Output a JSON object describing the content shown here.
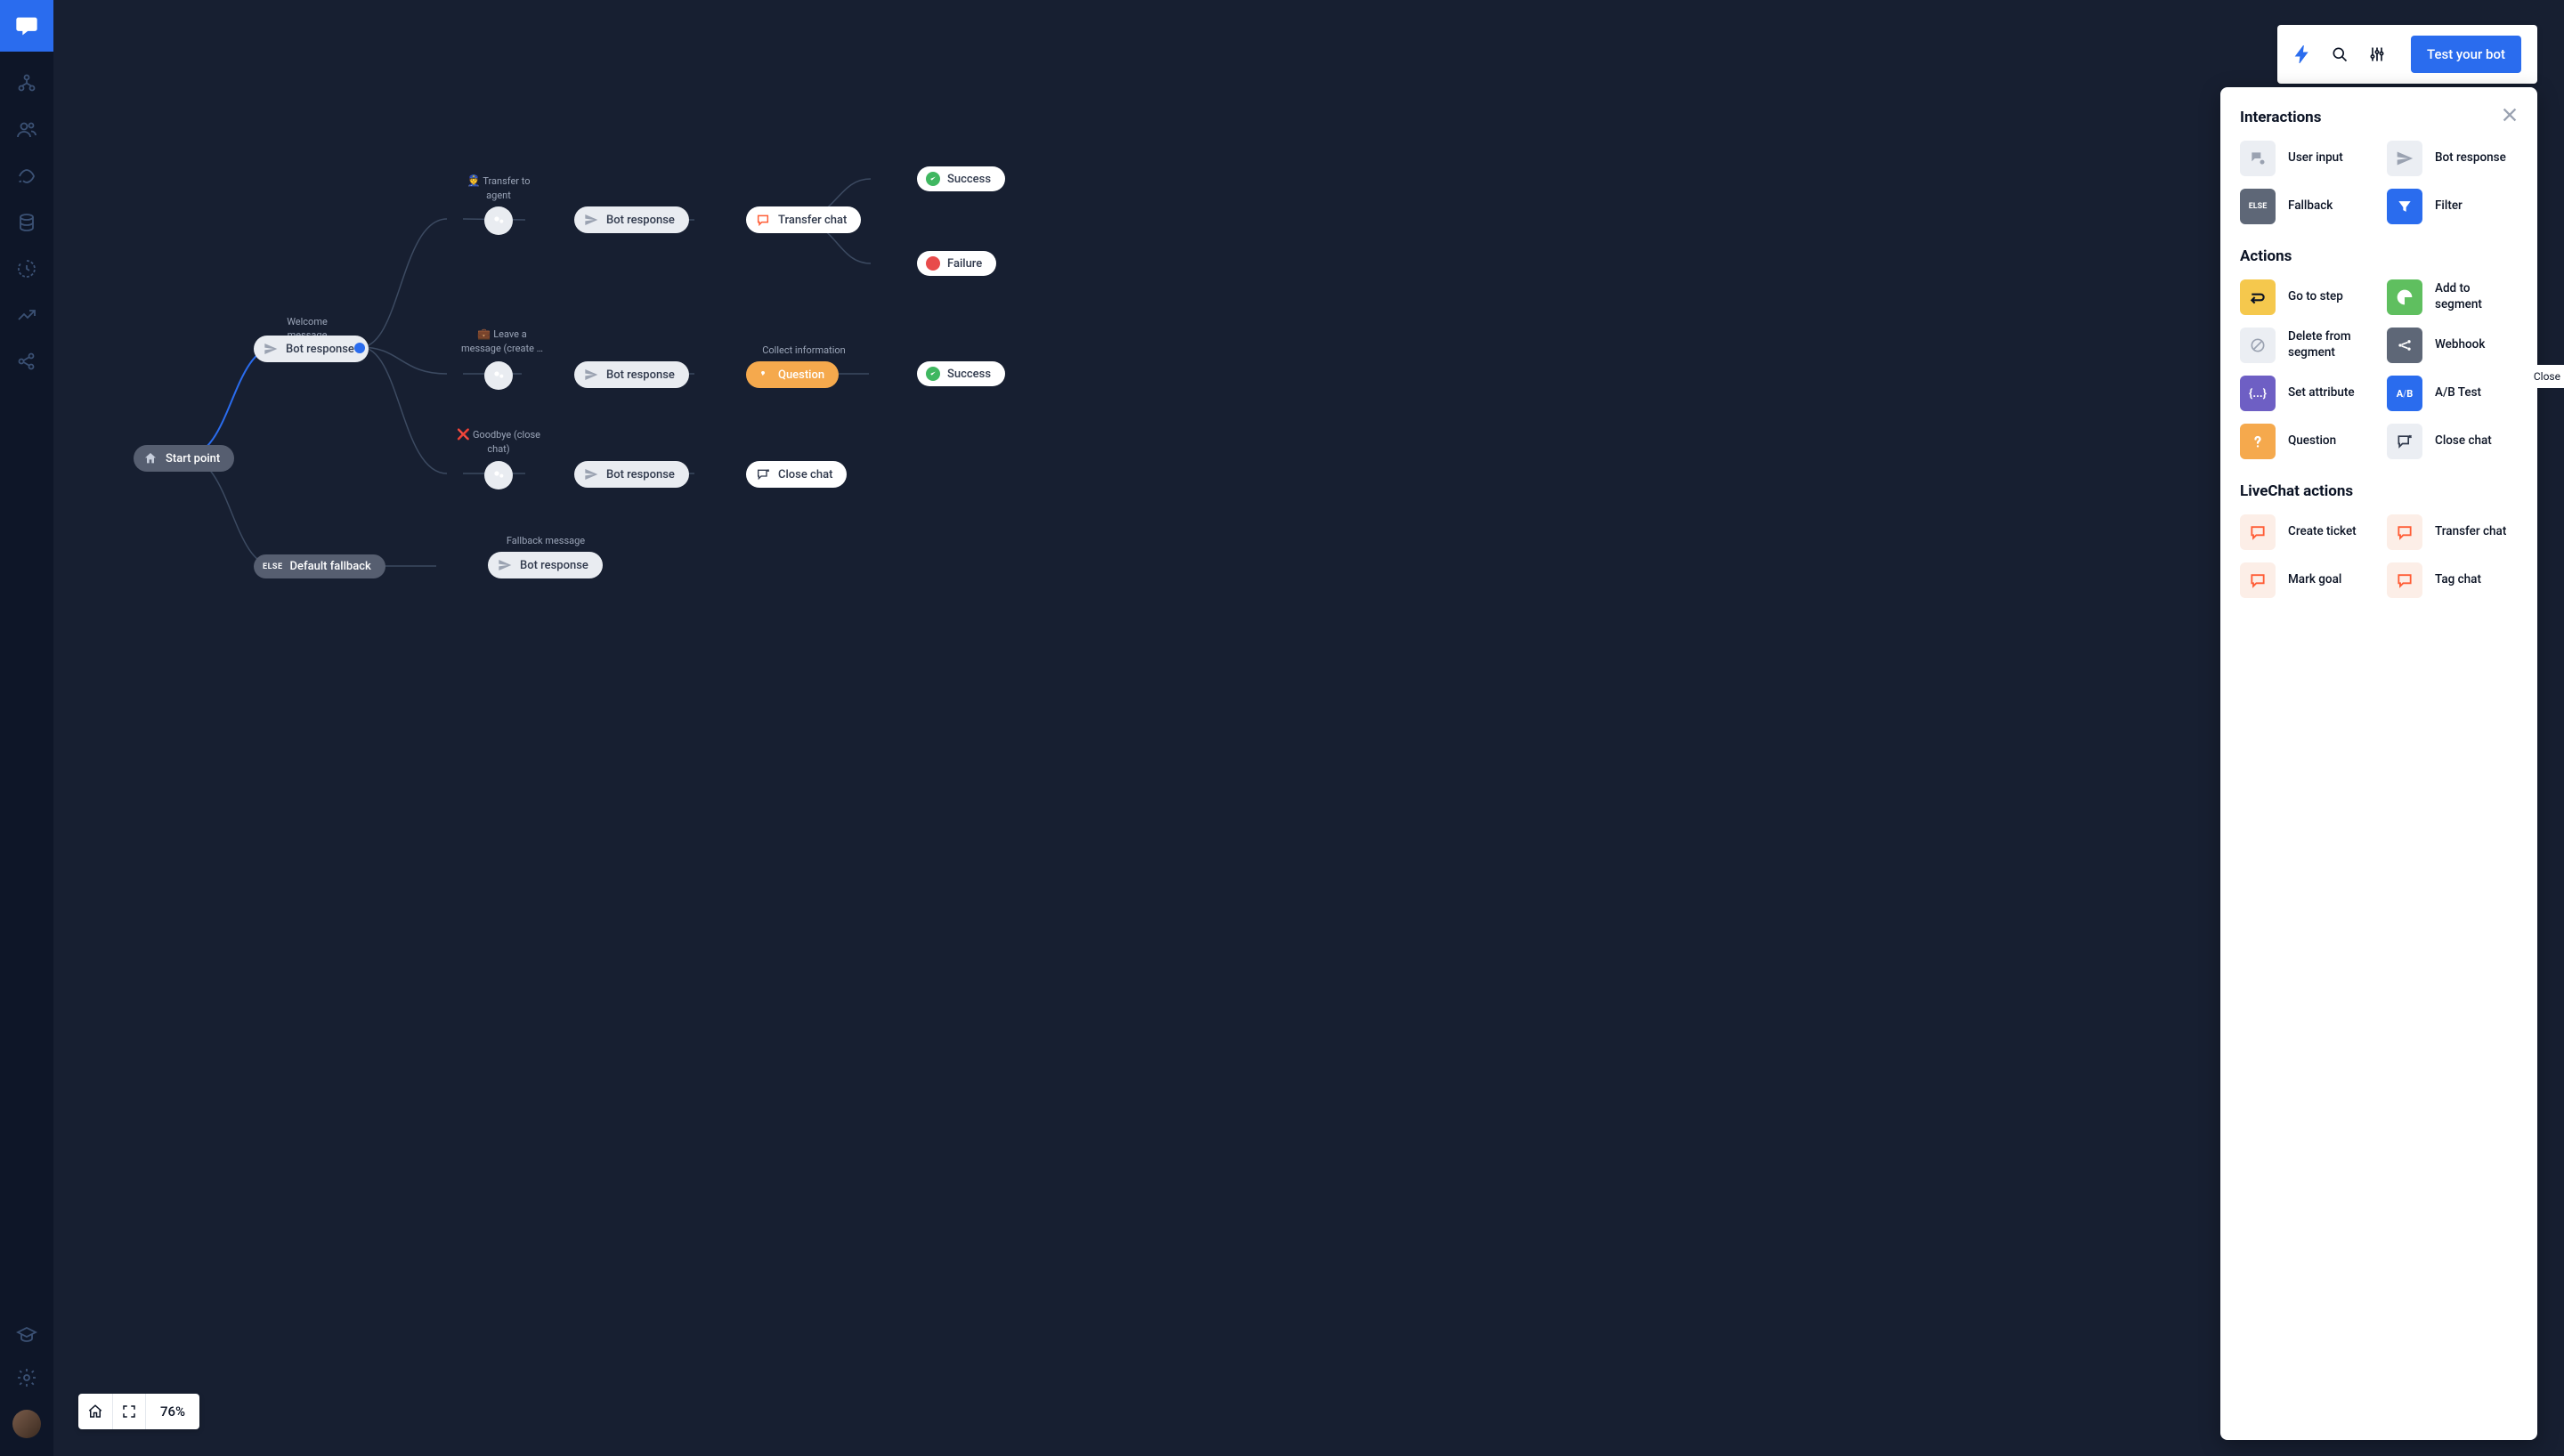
{
  "topbar": {
    "test_button": "Test your bot"
  },
  "zoom": {
    "value": "76%"
  },
  "nodes": {
    "start": "Start point",
    "welcome_label": "Welcome message",
    "welcome": "Bot response",
    "fallback_label": "Default fallback",
    "fallback_else": "ELSE",
    "transfer_label_pre": "👮 ",
    "transfer_label": "Transfer to agent",
    "leave_label_pre": "💼 ",
    "leave_label": "Leave a message (create …",
    "goodbye_label_pre": "❌ ",
    "goodbye_label": "Goodbye (close chat)",
    "fallback_msg_label": "Fallback message",
    "bot_response": "Bot response",
    "transfer_chat": "Transfer chat",
    "collect_label": "Collect information",
    "question": "Question",
    "close_chat": "Close chat",
    "success": "Success",
    "failure": "Failure"
  },
  "panel": {
    "sec1": "Interactions",
    "sec2": "Actions",
    "sec3": "LiveChat actions",
    "items": {
      "user_input": "User input",
      "bot_response": "Bot response",
      "fallback": "Fallback",
      "filter": "Filter",
      "goto": "Go to step",
      "add_seg": "Add to segment",
      "del_seg": "Delete from segment",
      "webhook": "Webhook",
      "set_attr": "Set attribute",
      "abtest": "A/B Test",
      "question": "Question",
      "close_chat": "Close chat",
      "create_ticket": "Create ticket",
      "transfer_chat": "Transfer chat",
      "mark_goal": "Mark goal",
      "tag_chat": "Tag chat"
    },
    "fallback_else": "ELSE"
  },
  "close_tab": "Close"
}
